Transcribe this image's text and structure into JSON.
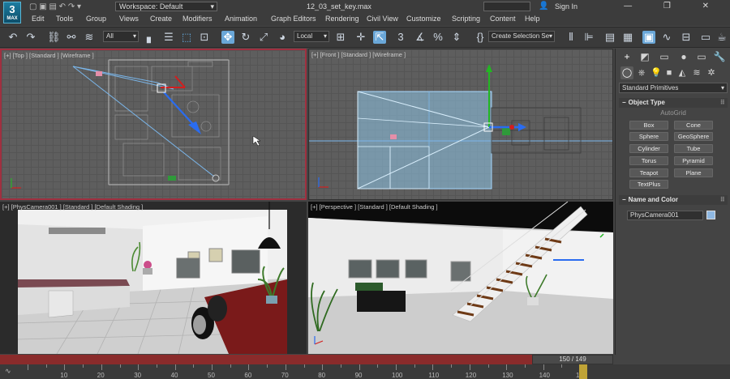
{
  "app": {
    "logo_text": "3",
    "logo_sub": "MAX",
    "workspace_label": "Workspace: Default",
    "file_name": "12_03_set_key.max",
    "sign_in": "Sign In",
    "window_controls": "—  ❐  ✕",
    "quick_access": "▢ ▣ ▤ ↶ ↷ ▾"
  },
  "menu": [
    "Edit",
    "Tools",
    "Group",
    "Views",
    "Create",
    "Modifiers",
    "Animation",
    "Graph Editors",
    "Rendering",
    "Civil View",
    "Customize",
    "Scripting",
    "Content",
    "Help"
  ],
  "toolbar": {
    "filter_value": "All",
    "coord_value": "Local",
    "selection_set_value": "Create Selection Se"
  },
  "viewports": {
    "top": {
      "label": "[+] [Top ] [Standard ] [Wireframe ]"
    },
    "front": {
      "label": "[+] [Front ] [Standard ] [Wireframe ]"
    },
    "camera": {
      "label": "[+] [PhysCamera001 ] [Standard ] [Default Shading ]"
    },
    "perspective": {
      "label": "[+] [Perspective ] [Standard ] [Default Shading ]"
    }
  },
  "command_panel": {
    "primitives_dropdown": "Standard Primitives",
    "object_type_header": "Object Type",
    "autogrid": "AutoGrid",
    "object_buttons": [
      "Box",
      "Cone",
      "Sphere",
      "GeoSphere",
      "Cylinder",
      "Tube",
      "Torus",
      "Pyramid",
      "Teapot",
      "Plane",
      "TextPlus"
    ],
    "name_color_header": "Name and Color",
    "object_name": "PhysCamera001",
    "object_color": "#8fb8e2"
  },
  "timeline": {
    "time_display": "150 / 149",
    "ticks": [
      "10",
      "20",
      "30",
      "40",
      "50",
      "60",
      "70",
      "80",
      "90",
      "100",
      "110",
      "120",
      "130",
      "140",
      "150"
    ]
  }
}
